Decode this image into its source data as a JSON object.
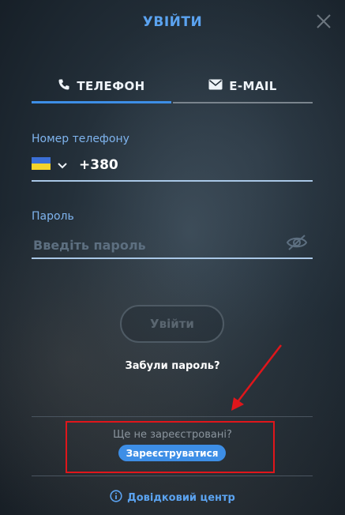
{
  "header": {
    "title": "УВІЙТИ"
  },
  "tabs": [
    {
      "label": "ТЕЛЕФОН",
      "icon": "phone-icon",
      "active": true
    },
    {
      "label": "E-MAIL",
      "icon": "envelope-icon",
      "active": false
    }
  ],
  "phone": {
    "label": "Номер телефону",
    "country_flag": "ukraine-flag-icon",
    "code": "+380"
  },
  "password": {
    "label": "Пароль",
    "placeholder": "Введіть пароль"
  },
  "login_button": "Увійти",
  "forgot_link": "Забули пароль?",
  "register": {
    "prompt": "Ще не зареєстровані?",
    "button": "Зареєструватися"
  },
  "help_link": "Довідковий центр",
  "colors": {
    "accent": "#3d8ee6",
    "title": "#5ba3f0",
    "highlight": "#e0161b"
  }
}
